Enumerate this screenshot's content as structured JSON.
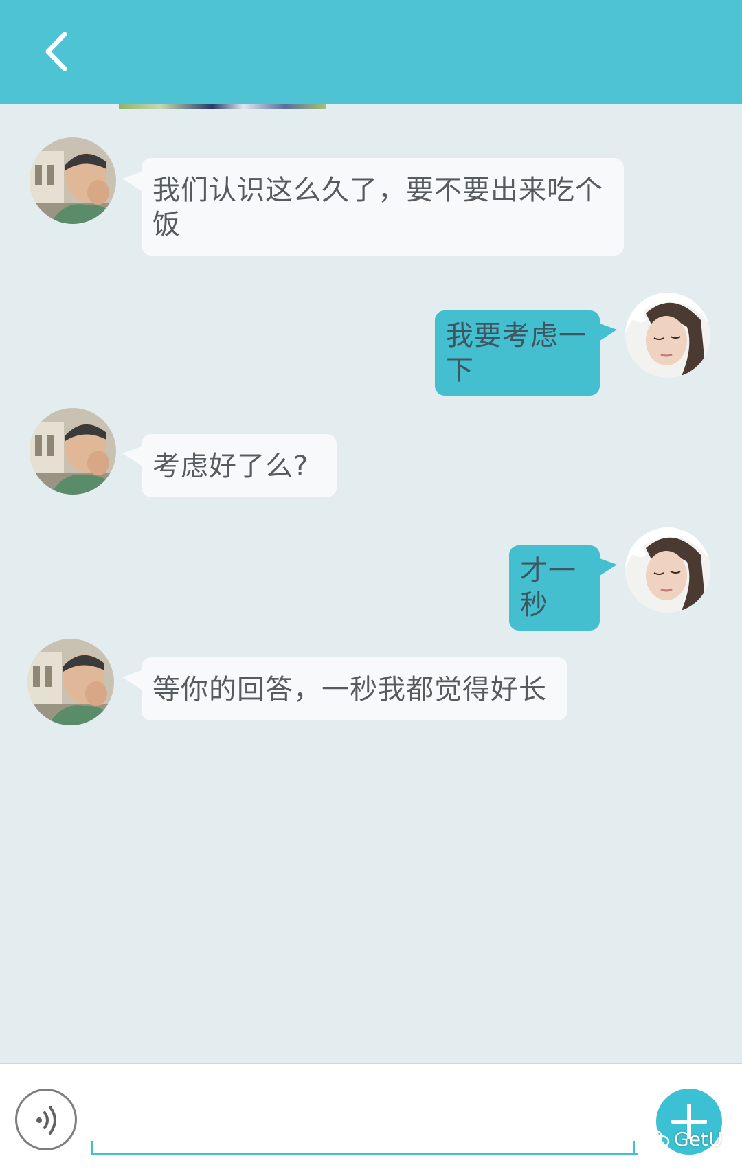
{
  "header": {
    "back_icon": "chevron-left-icon",
    "background_color": "#4dc3d3"
  },
  "messages": [
    {
      "side": "incoming",
      "avatar": "male-avatar",
      "text": "我们认识这么久了，要不要出来吃个饭"
    },
    {
      "side": "outgoing",
      "avatar": "female-avatar",
      "text": "我要考虑一下"
    },
    {
      "side": "incoming",
      "avatar": "male-avatar",
      "text": "考虑好了么?"
    },
    {
      "side": "outgoing",
      "avatar": "female-avatar",
      "text": "才一秒"
    },
    {
      "side": "incoming",
      "avatar": "male-avatar",
      "text": "等你的回答，一秒我都觉得好长"
    }
  ],
  "input_bar": {
    "voice_icon": "voice-icon",
    "text_value": "",
    "plus_icon": "plus-icon",
    "accent_color": "#43bfd0"
  },
  "watermark": {
    "text": "GetU",
    "icon": "wechat-icon"
  }
}
